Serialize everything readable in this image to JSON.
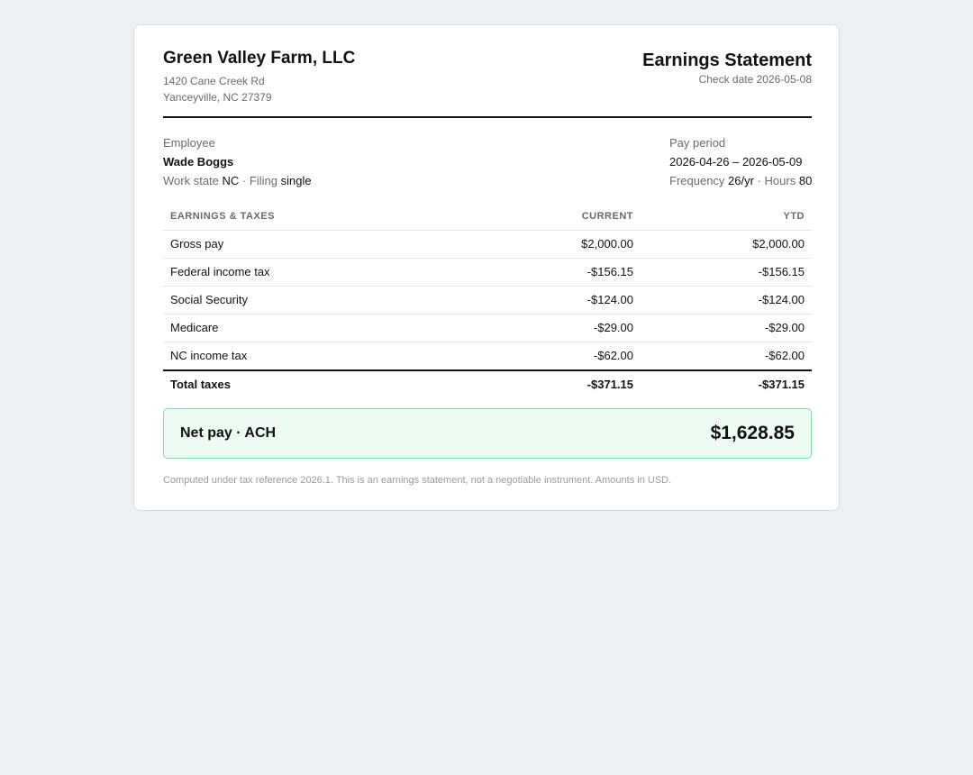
{
  "company": {
    "name": "Green Valley Farm, LLC",
    "address_line1": "1420 Cane Creek Rd",
    "address_line2": "Yanceyville, NC 27379"
  },
  "statement": {
    "title": "Earnings Statement",
    "check_date_label": "Check date",
    "check_date": "2026-05-08"
  },
  "employee": {
    "heading": "Employee",
    "name": "Wade Boggs",
    "work_state_label": "Work state",
    "work_state": "NC",
    "filing_label": "Filing",
    "filing": "single"
  },
  "pay_period": {
    "heading": "Pay period",
    "range": "2026-04-26 – 2026-05-09",
    "frequency_label": "Frequency",
    "frequency": "26/yr",
    "hours_label": "Hours",
    "hours": "80"
  },
  "table": {
    "headers": [
      "EARNINGS & TAXES",
      "CURRENT",
      "YTD"
    ],
    "rows": [
      {
        "label": "Gross pay",
        "current": "$2,000.00",
        "ytd": "$2,000.00"
      },
      {
        "label": "Federal income tax",
        "current": "-$156.15",
        "ytd": "-$156.15"
      },
      {
        "label": "Social Security",
        "current": "-$124.00",
        "ytd": "-$124.00"
      },
      {
        "label": "Medicare",
        "current": "-$29.00",
        "ytd": "-$29.00"
      },
      {
        "label": "NC income tax",
        "current": "-$62.00",
        "ytd": "-$62.00"
      }
    ],
    "total": {
      "label": "Total taxes",
      "current": "-$371.15",
      "ytd": "-$371.15"
    }
  },
  "net_pay": {
    "label": "Net pay · ACH",
    "amount": "$1,628.85"
  },
  "footnote": "Computed under tax reference 2026.1. This is an earnings statement, not a negotiable instrument. Amounts in USD.",
  "colors": {
    "page_background": "#edf0f2",
    "net_pay_background": "#edfcf2",
    "net_pay_border": "#86dca4"
  }
}
